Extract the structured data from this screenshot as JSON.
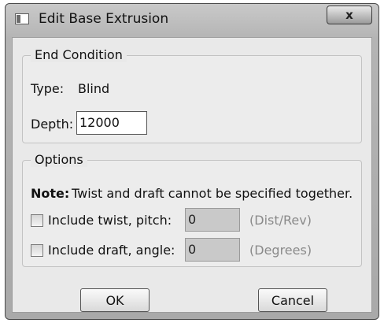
{
  "window": {
    "title": "Edit Base Extrusion",
    "close_glyph": "x",
    "icon": "window-icon"
  },
  "end_condition": {
    "legend": "End Condition",
    "type_label": "Type:",
    "type_value": "Blind",
    "depth_label": "Depth:",
    "depth_value": "12000"
  },
  "options": {
    "legend": "Options",
    "note_label": "Note:",
    "note_text": "Twist and draft cannot be specified together.",
    "twist": {
      "label": "Include twist, pitch:",
      "value": "0",
      "unit": "(Dist/Rev)",
      "checked": false
    },
    "draft": {
      "label": "Include draft, angle:",
      "value": "0",
      "unit": "(Degrees)",
      "checked": false
    }
  },
  "buttons": {
    "ok": "OK",
    "cancel": "Cancel"
  }
}
